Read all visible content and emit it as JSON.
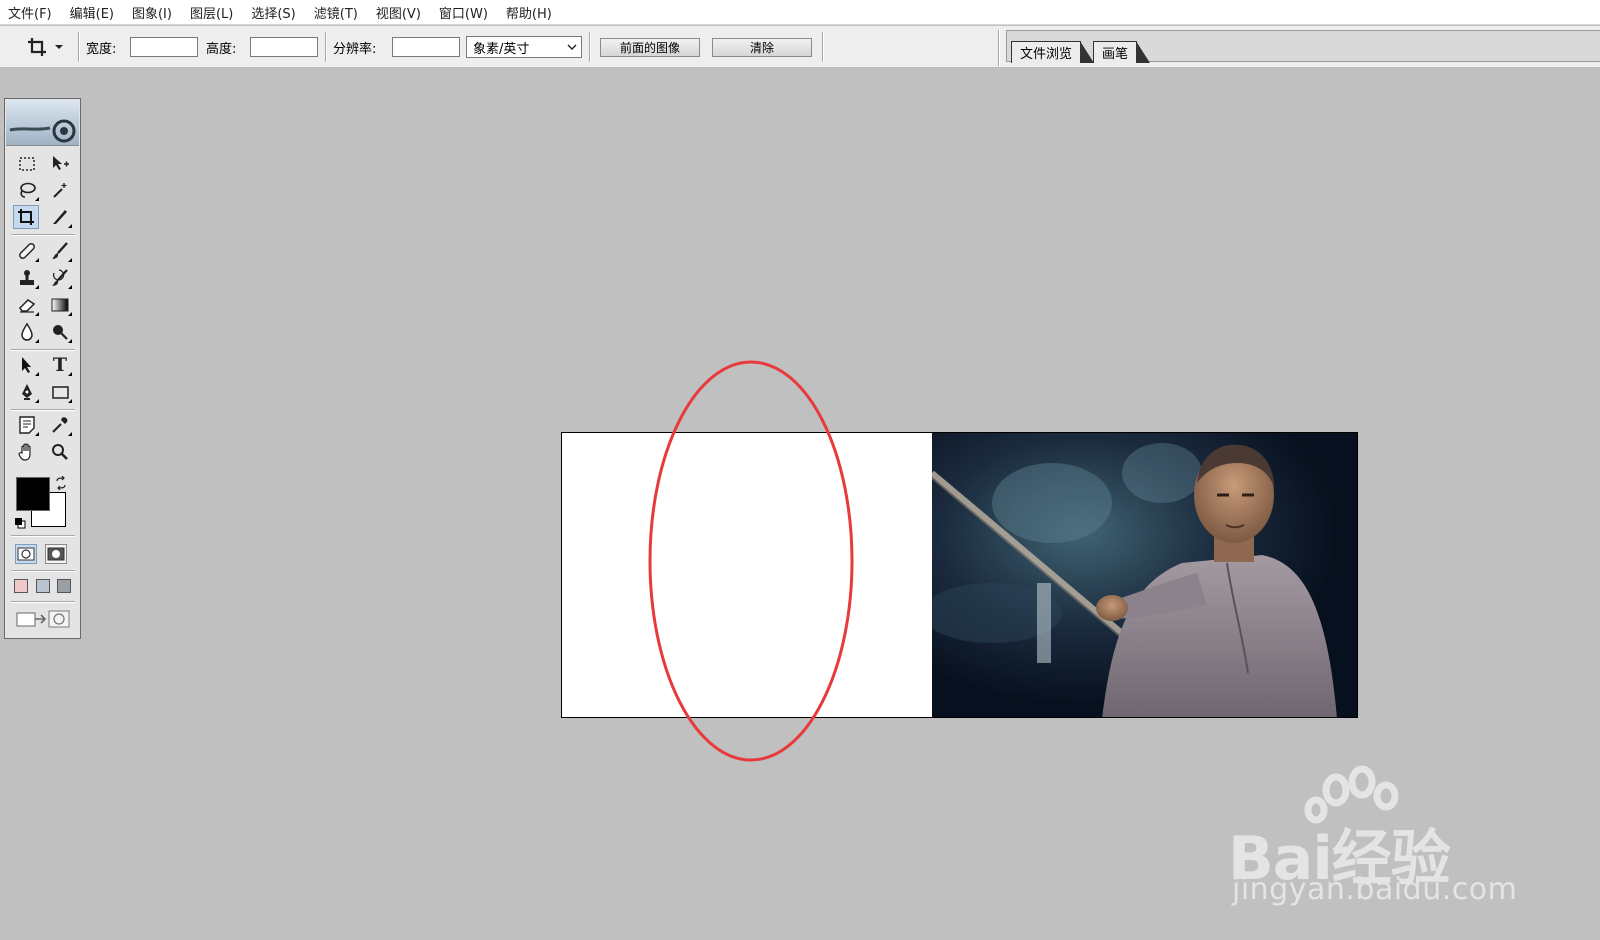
{
  "menu": [
    "文件(F)",
    "编辑(E)",
    "图象(I)",
    "图层(L)",
    "选择(S)",
    "滤镜(T)",
    "视图(V)",
    "窗口(W)",
    "帮助(H)"
  ],
  "options": {
    "width_label": "宽度:",
    "height_label": "高度:",
    "resolution_label": "分辨率:",
    "unit_select": "象素/英寸",
    "front_image_button": "前面的图像",
    "clear_button": "清除",
    "width_value": "",
    "height_value": "",
    "resolution_value": ""
  },
  "palette_well": {
    "tabs": [
      "文件浏览",
      "画笔"
    ]
  },
  "tools": [
    {
      "id": "marquee",
      "icon": "marquee-icon"
    },
    {
      "id": "move",
      "icon": "move-icon"
    },
    {
      "id": "lasso",
      "icon": "lasso-icon"
    },
    {
      "id": "magic-wand",
      "icon": "magic-wand-icon"
    },
    {
      "id": "crop",
      "icon": "crop-icon",
      "active": true
    },
    {
      "id": "slice",
      "icon": "slice-icon"
    },
    {
      "id": "healing",
      "icon": "healing-brush-icon"
    },
    {
      "id": "brush",
      "icon": "brush-icon"
    },
    {
      "id": "stamp",
      "icon": "clone-stamp-icon"
    },
    {
      "id": "history-brush",
      "icon": "history-brush-icon"
    },
    {
      "id": "eraser",
      "icon": "eraser-icon"
    },
    {
      "id": "gradient",
      "icon": "gradient-icon"
    },
    {
      "id": "blur",
      "icon": "blur-icon"
    },
    {
      "id": "dodge",
      "icon": "dodge-icon"
    },
    {
      "id": "path-select",
      "icon": "path-selection-icon"
    },
    {
      "id": "type",
      "icon": "type-icon",
      "glyph": "T"
    },
    {
      "id": "pen",
      "icon": "pen-icon"
    },
    {
      "id": "shape",
      "icon": "shape-icon"
    },
    {
      "id": "notes",
      "icon": "notes-icon"
    },
    {
      "id": "eyedropper",
      "icon": "eyedropper-icon"
    },
    {
      "id": "hand",
      "icon": "hand-icon"
    },
    {
      "id": "zoom",
      "icon": "zoom-icon"
    }
  ],
  "colors": {
    "foreground": "#000000",
    "background": "#ffffff",
    "workspace": "#c0c0c0",
    "annotation": "#e8393b"
  },
  "watermark": {
    "brand": "Bai经验",
    "url": "jingyan.baidu.com"
  }
}
